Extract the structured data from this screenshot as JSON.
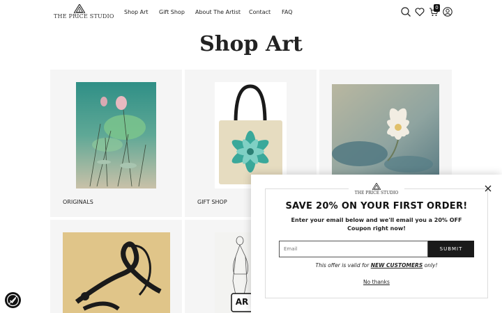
{
  "header": {
    "logo_text": "THE PRICE STUDIO",
    "nav": [
      "Shop Art",
      "Gift Shop",
      "About The Artist",
      "Contact",
      "FAQ"
    ],
    "icons": [
      "search-icon",
      "heart-icon",
      "cart-icon",
      "account-icon"
    ],
    "cart_count": "0"
  },
  "page": {
    "title": "Shop Art"
  },
  "cards": [
    {
      "label": "ORIGINALS"
    },
    {
      "label": "GIFT SHOP"
    },
    {
      "label": ""
    },
    {
      "label": ""
    },
    {
      "label": ""
    }
  ],
  "popup": {
    "logo_text": "THE PRICE STUDIO",
    "headline": "SAVE 20% ON YOUR FIRST ORDER!",
    "subtext": "Enter your email below and we'll email you a 20% OFF Coupon right now!",
    "email_placeholder": "Email",
    "submit_label": "SUBMIT",
    "offer_prefix": "This offer is valid for ",
    "offer_bold": "NEW CUSTOMERS",
    "offer_suffix": " only!",
    "no_thanks": "No thanks"
  },
  "colors": {
    "dark": "#1a1a1a",
    "card_bg": "#f5f5f5"
  }
}
